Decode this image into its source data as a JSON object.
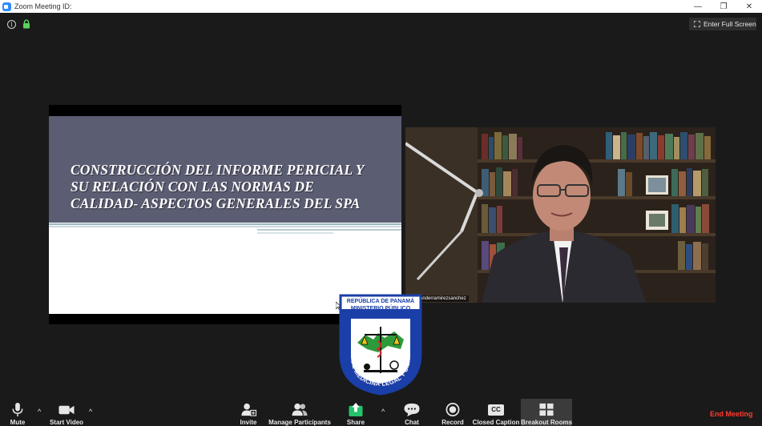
{
  "window": {
    "title": "Zoom Meeting ID:",
    "minimize_glyph": "—",
    "restore_glyph": "❐",
    "close_glyph": "✕"
  },
  "topbar": {
    "info_glyph": "i",
    "full_screen_label": "Enter Full Screen"
  },
  "share": {
    "slide_title_lines": [
      "CONSTRUCCIÓN DEL INFORME PERICIAL Y",
      "SU RELACIÓN CON LAS NORMAS DE",
      "CALIDAD- ASPECTOS GENERALES DEL SPA"
    ]
  },
  "video": {
    "participant_name": "alexanderramirezsanchez"
  },
  "seal": {
    "top_line_1": "REPÚBLICA DE PANAMÁ",
    "top_line_2": "MINISTERIO PÚBLICO",
    "ring_text": "INSTITUTO DE MEDICINA LEGAL Y CIENCIAS FORENSES"
  },
  "toolbar": {
    "mute": "Mute",
    "start_video": "Start Video",
    "invite": "Invite",
    "manage_participants": "Manage Participants",
    "share": "Share",
    "chat": "Chat",
    "record": "Record",
    "closed_caption": "Closed Caption",
    "cc_glyph": "CC",
    "breakout_rooms": "Breakout Rooms",
    "end_meeting": "End Meeting",
    "caret": "^"
  },
  "colors": {
    "accent_blue": "#2d8cff",
    "share_green": "#23c26b",
    "end_red": "#ff3b30",
    "lock_green": "#5bd35b",
    "slide_band": "#5b5d72",
    "seal_blue": "#1b3fa8"
  }
}
